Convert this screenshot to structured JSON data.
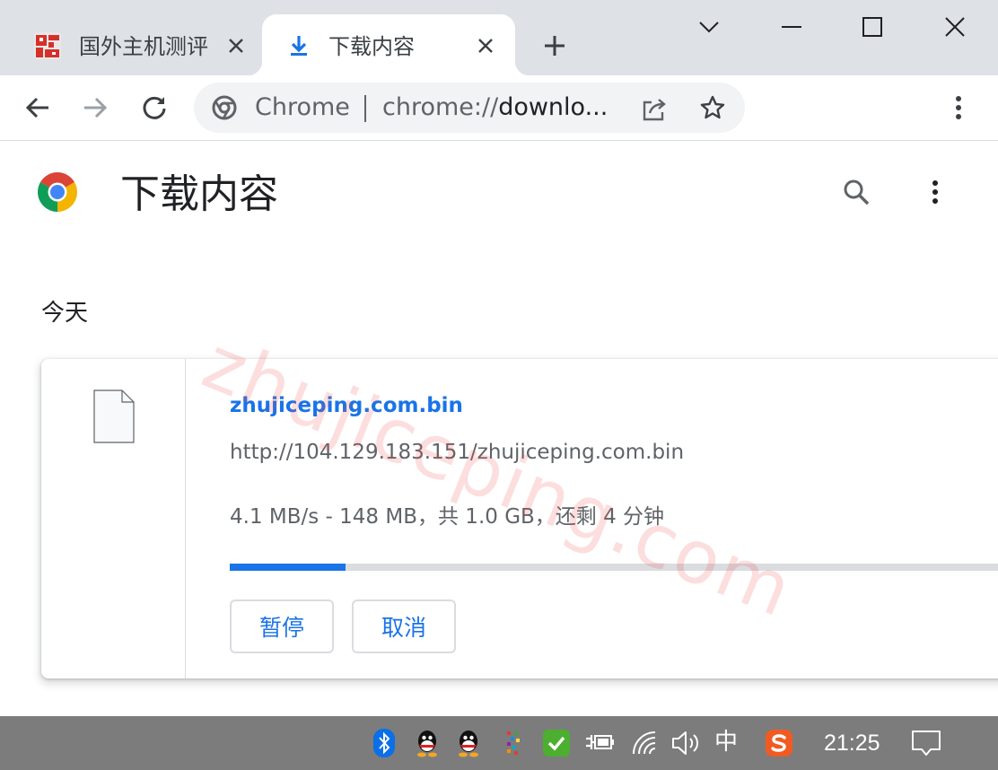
{
  "browser": {
    "tabs": [
      {
        "title": "国外主机测评",
        "active": false,
        "icon": "site-favicon-icon"
      },
      {
        "title": "下载内容",
        "active": true,
        "icon": "download-icon"
      }
    ],
    "omnibox": {
      "origin_label": "Chrome",
      "url_prefix": "chrome://",
      "url_host": "downlo..."
    }
  },
  "page": {
    "title": "下载内容",
    "date_header": "今天",
    "watermark": "zhujiceping.com"
  },
  "downloads": [
    {
      "file_name": "zhujiceping.com.bin",
      "url": "http://104.129.183.151/zhujiceping.com.bin",
      "status": "4.1 MB/s - 148 MB，共 1.0 GB，还剩 4 分钟",
      "progress": 0.148,
      "pause_label": "暂停",
      "cancel_label": "取消"
    }
  ],
  "taskbar": {
    "ime": "中",
    "clock": "21:25",
    "tray_icons": [
      "bluetooth-icon",
      "qq-icon",
      "qq-icon",
      "color-grid-app-icon",
      "security-check-icon",
      "power-plug-icon",
      "wifi-icon",
      "volume-icon",
      "sogou-input-icon",
      "notification-icon"
    ]
  },
  "colors": {
    "accent": "#1a73e8",
    "tabstrip": "#dee1e6",
    "taskbar": "#7c7c7c",
    "watermark": "#ef4848"
  }
}
